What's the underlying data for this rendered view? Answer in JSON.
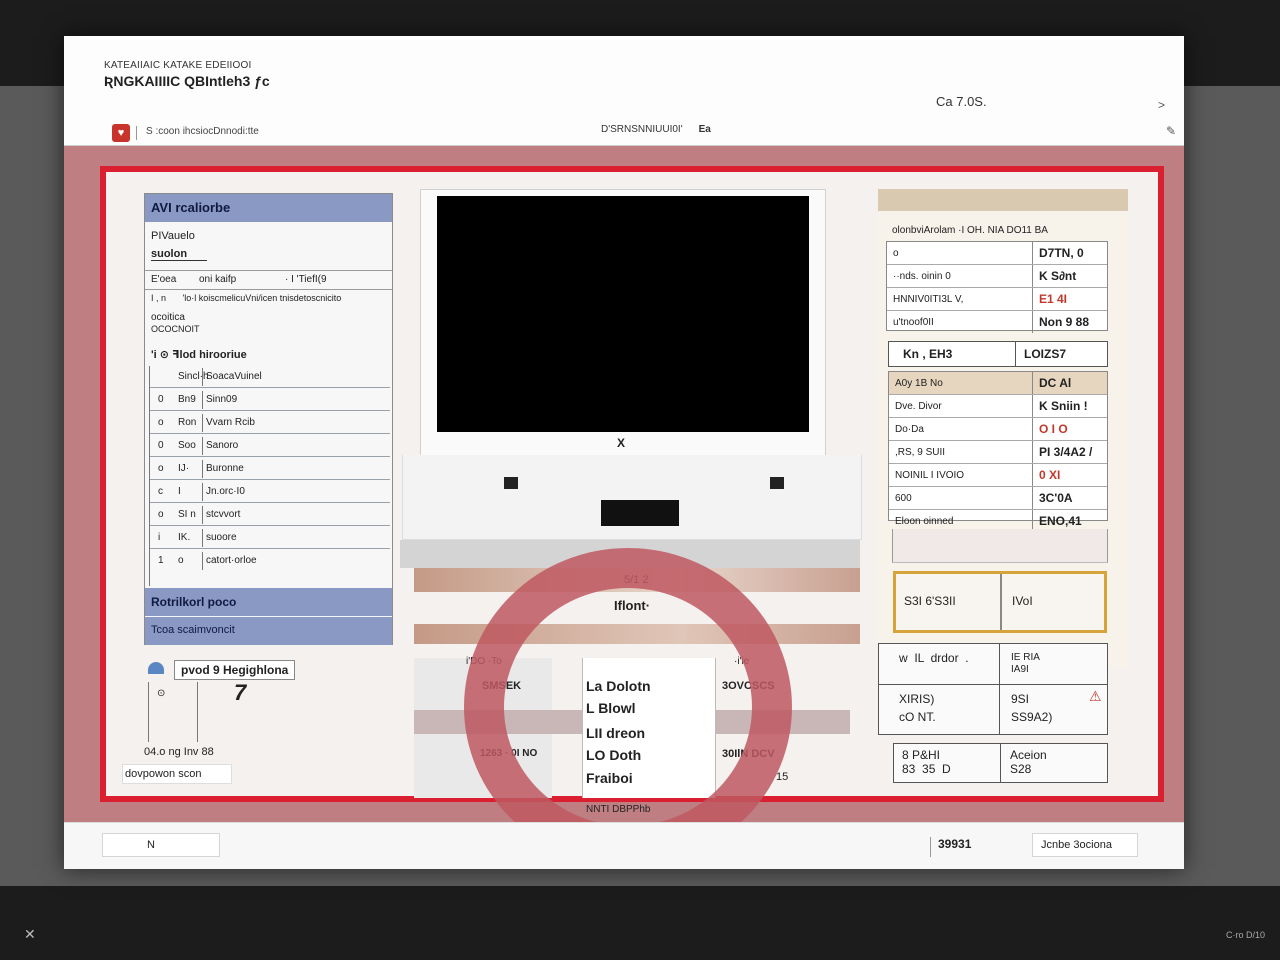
{
  "window": {
    "title_small": "KATEAIIAIC KATAKE EDEIIOOI",
    "title_main": "ƦNGKAIIIIC QBIntleh3 ƒc",
    "header_right": "Ca 7.0S.",
    "header_arrow": ">"
  },
  "toolbar": {
    "app_icon": "♥",
    "left_text": "S  :coon  ihcsiocDnnodi:tte",
    "mid_text": "D'SRNSNNIUUI0I'",
    "mid_badge": "Ea"
  },
  "left_panel": {
    "header": "AVI rcaliorbe",
    "line1": "PIVauelo",
    "line2": "suolon",
    "tabs": [
      "E'oea",
      "oni  kaifp",
      "·  I 'TiefI(9"
    ],
    "row_a": [
      "I  ,  n",
      "'lo·l koiscmelicuVni/icen tnisdetoscnicito"
    ],
    "line3": "ocoitica",
    "line4": "OCOCNOIT",
    "section": "'i  ⊙ ꟻlod hirooriue",
    "rows": [
      {
        "c1": "",
        "c2": "Sincl·h",
        "c3": "SoacaVuinel"
      },
      {
        "c1": "0",
        "c2": "Bn9",
        "c3": "Sinn09"
      },
      {
        "c1": "o",
        "c2": "Ron",
        "c3": "Vvarn Rcib"
      },
      {
        "c1": "0",
        "c2": "Soo",
        "c3": "Sanoro"
      },
      {
        "c1": "o",
        "c2": "IJ·",
        "c3": "Buronne"
      },
      {
        "c1": "c",
        "c2": "I",
        "c3": "Jn.orc·I0"
      },
      {
        "c1": "o",
        "c2": "SI n",
        "c3": "stcvvort"
      },
      {
        "c1": "i",
        "c2": "IK.",
        "c3": "suoore"
      },
      {
        "c1": "1",
        "c2": "o",
        "c3": "catort·orloe"
      }
    ],
    "footer1": "Rotrilkorl poco",
    "footer2": "Tcoa scaimvoncit"
  },
  "lower_left": {
    "tag": "pvod 9 Hegighlona",
    "glyph": "7",
    "label1": "04.o ng  Inv 88",
    "label2": "dovpowon  scon"
  },
  "monitor": {
    "brand": "X"
  },
  "middle": {
    "label1": "5/1 2",
    "label2": "Iflont·",
    "table": [
      {
        "a": "i'DO  ·To",
        "b": "",
        "c": "·i'ie"
      },
      {
        "a": "SMSEK",
        "b": "La   Dolotn",
        "c": "3OVCSCS"
      },
      {
        "a": "",
        "b": "L   Blowl",
        "c": ""
      },
      {
        "a": "",
        "b": "LII  dreon",
        "c": ""
      },
      {
        "a": "1263 · 0I NO",
        "b": "LO   Doth",
        "c": "30IlN DCV"
      },
      {
        "a": "",
        "b": "     Fraiboi",
        "c": "15"
      },
      {
        "a": "",
        "b": "NNTI  DBPPhb",
        "c": ""
      }
    ]
  },
  "right_panel": {
    "header_text": "olonbviArolam   ·I OH.  NIA  DO11  BA",
    "box1": [
      {
        "k": "o",
        "v": "D7TN,  0"
      },
      {
        "k": "··nds.  oinin 0",
        "v": "K S∂nt"
      },
      {
        "k": "  HNNIV0ITI3L  V,",
        "v": "E1 4I"
      },
      {
        "k": "  u'tnoof0II",
        "v": "Non  9  88"
      }
    ],
    "box2_head": [
      "Kn  ,  EH3",
      "LOIZS7"
    ],
    "box2": [
      {
        "k": "A0y 1B  No",
        "v": "DC  Al"
      },
      {
        "k": "  Dve.   Divor",
        "v": "K  Sniin  !"
      },
      {
        "k": "  Do·Da",
        "v": "O I  O"
      },
      {
        "k": "  ,RS, 9  SUII",
        "v": "PI  3/4A2  /"
      },
      {
        "k": "NOINIL  I IVOIO",
        "v": "0  XI"
      },
      {
        "k": "      600",
        "v": "3C'0A"
      },
      {
        "k": "  Eloon  oinned",
        "v": "ENO,41"
      }
    ],
    "yellow": [
      "S3I  6'S3II",
      "IVoI"
    ],
    "grid": [
      [
        "w  IL  drdor  .",
        "IE RIA\nIA9I"
      ],
      [
        "XIRIS)\ncO NT.",
        "9SI\nSS9A2)"
      ],
      [
        "8 P&HI\n83  35  D",
        "Aceion\nS28"
      ]
    ]
  },
  "bottom_bar": {
    "input_text": "N",
    "status": "39931",
    "button": "Jcnbe 3ociona"
  },
  "corners": {
    "left_icon": "✕",
    "right_text": "C·ro  D/10"
  }
}
